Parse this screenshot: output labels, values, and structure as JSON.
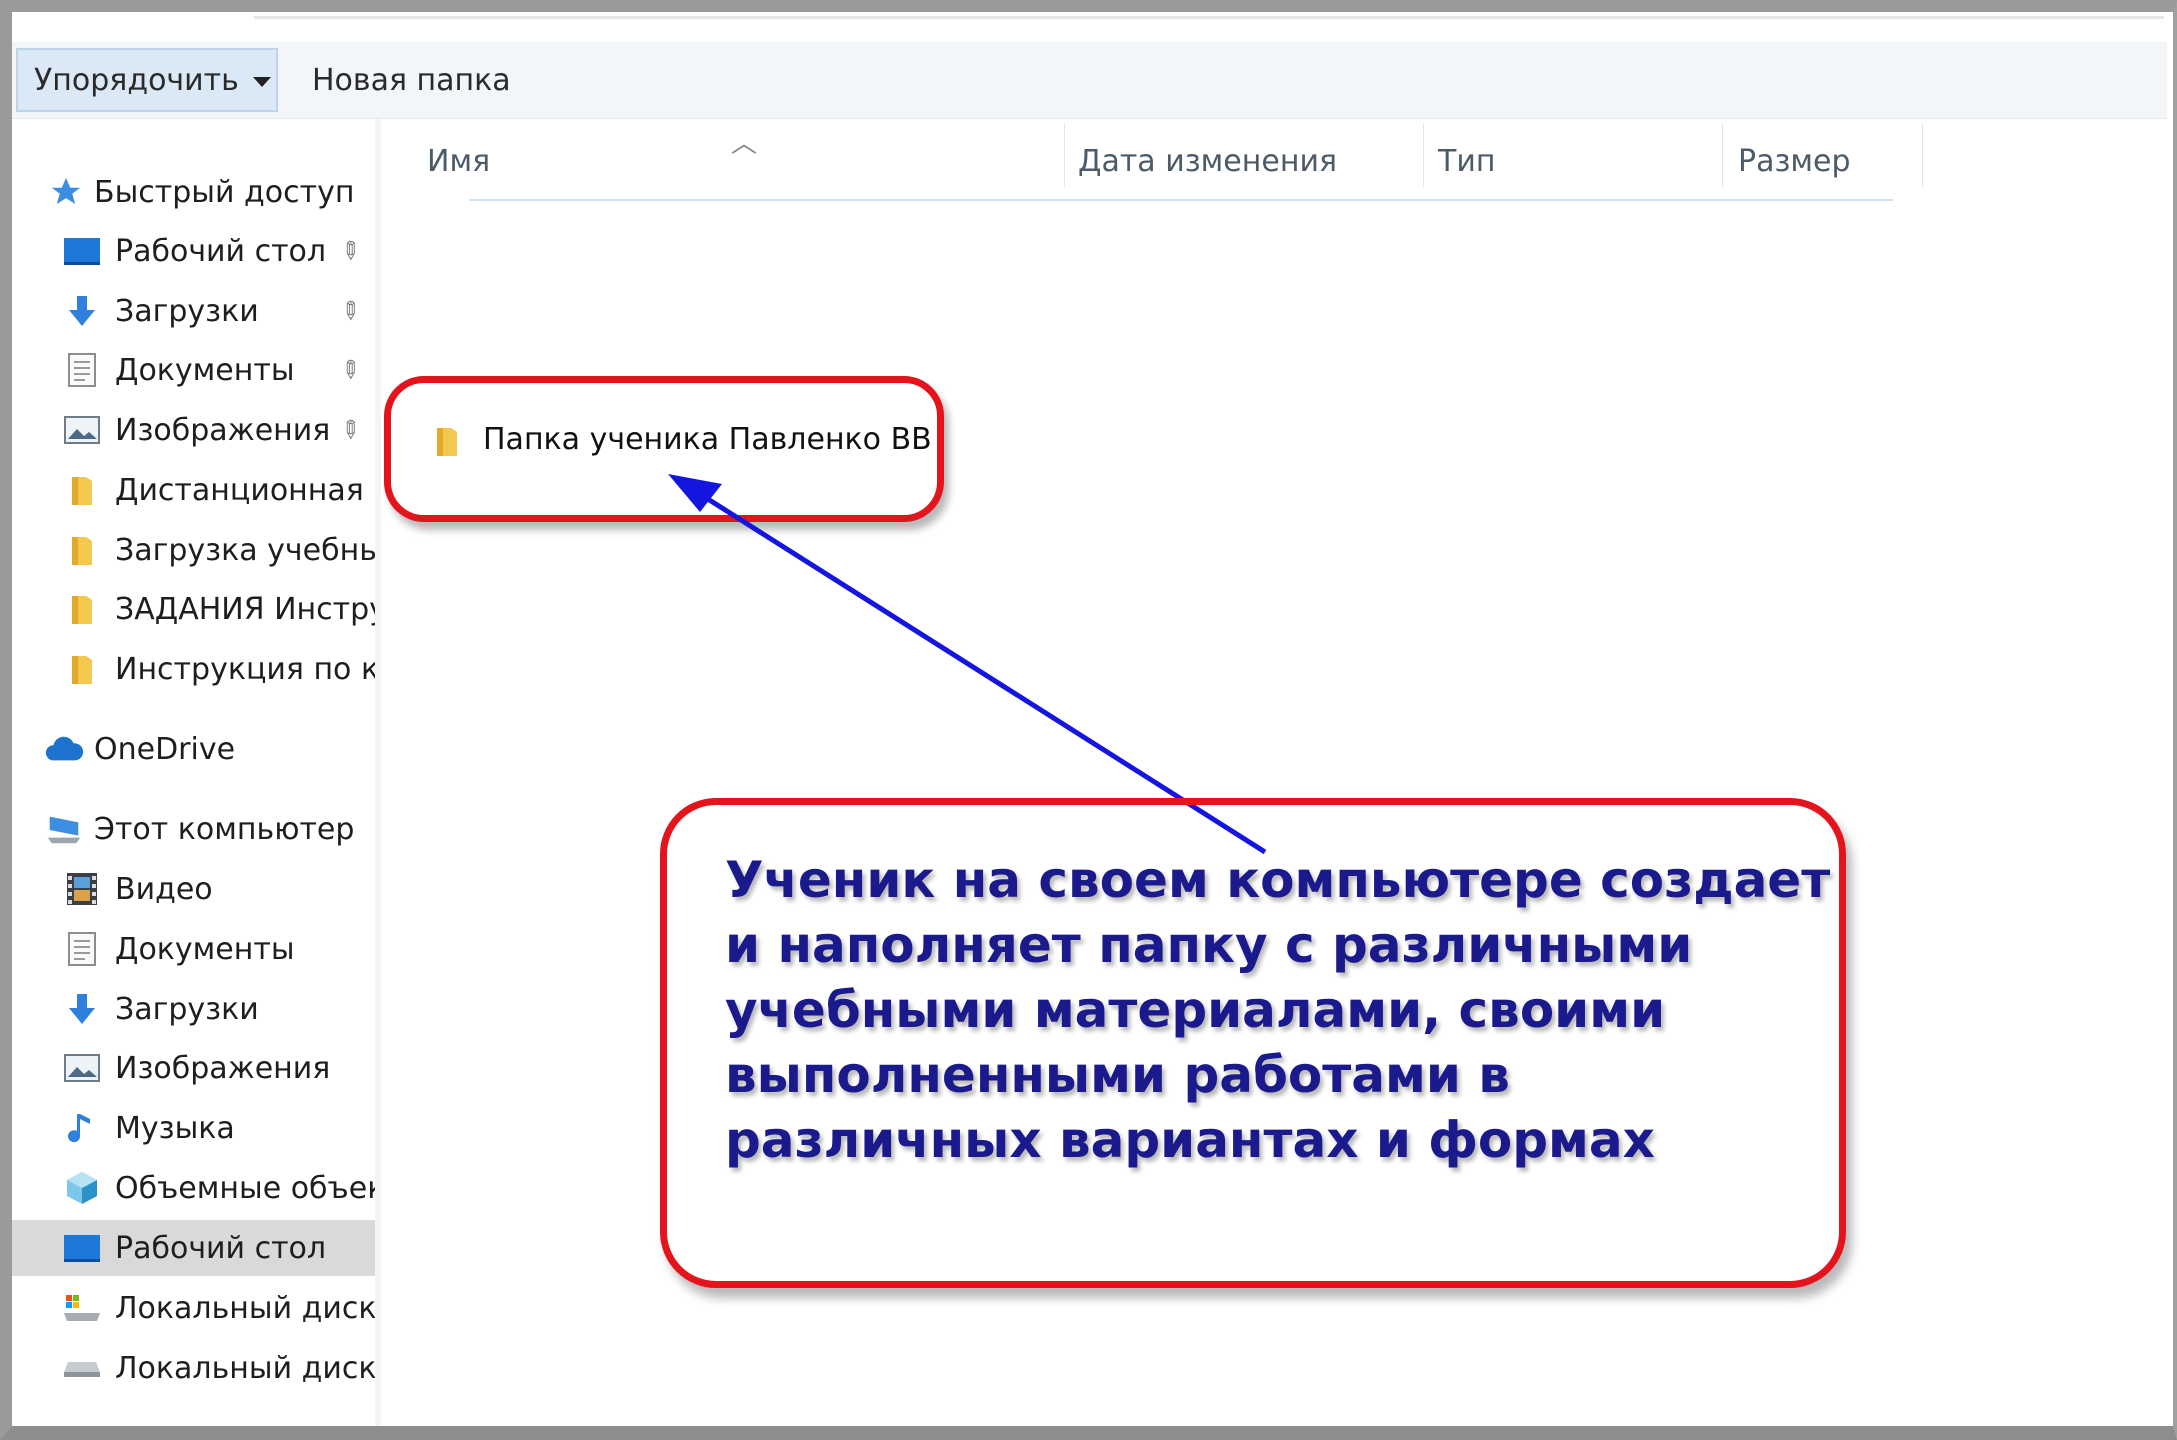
{
  "toolbar": {
    "organize_label": "Упорядочить",
    "new_folder_label": "Новая папка"
  },
  "nav": {
    "quick_access": "Быстрый доступ",
    "quick_items": [
      {
        "label": "Рабочий стол",
        "icon": "desktop-icon",
        "pinned": true
      },
      {
        "label": "Загрузки",
        "icon": "download-icon",
        "pinned": true
      },
      {
        "label": "Документы",
        "icon": "documents-icon",
        "pinned": true
      },
      {
        "label": "Изображения",
        "icon": "pictures-icon",
        "pinned": true
      },
      {
        "label": "Дистанционная во",
        "icon": "folder-icon",
        "pinned": false
      },
      {
        "label": "Загрузка учебных м",
        "icon": "folder-icon",
        "pinned": false
      },
      {
        "label": "ЗАДАНИЯ Инструк",
        "icon": "folder-icon",
        "pinned": false
      },
      {
        "label": "Инструкция по кур",
        "icon": "folder-icon",
        "pinned": false
      }
    ],
    "onedrive": "OneDrive",
    "this_pc": "Этот компьютер",
    "pc_items": [
      {
        "label": "Видео",
        "icon": "video-icon"
      },
      {
        "label": "Документы",
        "icon": "documents-icon"
      },
      {
        "label": "Загрузки",
        "icon": "download-icon"
      },
      {
        "label": "Изображения",
        "icon": "pictures-icon"
      },
      {
        "label": "Музыка",
        "icon": "music-icon"
      },
      {
        "label": "Объемные объекты",
        "icon": "3d-objects-icon"
      },
      {
        "label": "Рабочий стол",
        "icon": "desktop-icon",
        "selected": true
      },
      {
        "label": "Локальный диск (C",
        "icon": "drive-c-icon"
      },
      {
        "label": "Локальный диск (D",
        "icon": "drive-d-icon"
      }
    ]
  },
  "columns": {
    "name": "Имя",
    "date": "Дата изменения",
    "type": "Тип",
    "size": "Размер"
  },
  "files": [
    {
      "name": "Папка ученика Павленко ВВ",
      "icon": "folder-icon"
    }
  ],
  "annotation": {
    "lines": [
      "Ученик на своем компьютере создает",
      "и наполняет папку с различными",
      "учебными материалами, своими",
      "выполненными работами в",
      "различных вариантах и формах"
    ],
    "border_color": "#e3141b",
    "text_color": "#1a1a8c",
    "arrow_color": "#1515e0"
  },
  "colors": {
    "selection": "#d9d9d9",
    "toolbar_active": "#dbe8f5",
    "folder": "#f3c84d"
  }
}
